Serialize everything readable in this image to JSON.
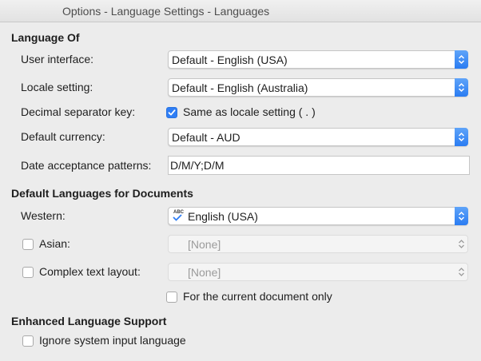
{
  "window": {
    "title": "Options - Language Settings - Languages"
  },
  "language_of": {
    "heading": "Language Of",
    "user_interface": {
      "label": "User interface:",
      "value": "Default - English (USA)"
    },
    "locale_setting": {
      "label": "Locale setting:",
      "value": "Default - English (Australia)"
    },
    "decimal_separator": {
      "label": "Decimal separator key:",
      "checkbox_label": "Same as locale setting ( . )",
      "checked": true
    },
    "default_currency": {
      "label": "Default currency:",
      "value": "Default - AUD"
    },
    "date_patterns": {
      "label": "Date acceptance patterns:",
      "value": "D/M/Y;D/M"
    }
  },
  "default_languages": {
    "heading": "Default Languages for Documents",
    "western": {
      "label": "Western:",
      "value": "English (USA)",
      "icon": "spellcheck-abc-icon"
    },
    "asian": {
      "label": "Asian:",
      "value": "[None]",
      "checked": false,
      "enabled": false
    },
    "ctl": {
      "label": "Complex text layout:",
      "value": "[None]",
      "checked": false,
      "enabled": false
    },
    "current_doc_only": {
      "label": "For the current document only",
      "checked": false
    }
  },
  "enhanced": {
    "heading": "Enhanced Language Support",
    "ignore_input": {
      "label": "Ignore system input language",
      "checked": false
    }
  },
  "colors": {
    "accent": "#2f7ef5",
    "background": "#ececec",
    "disabled_text": "#9b9b9b"
  }
}
